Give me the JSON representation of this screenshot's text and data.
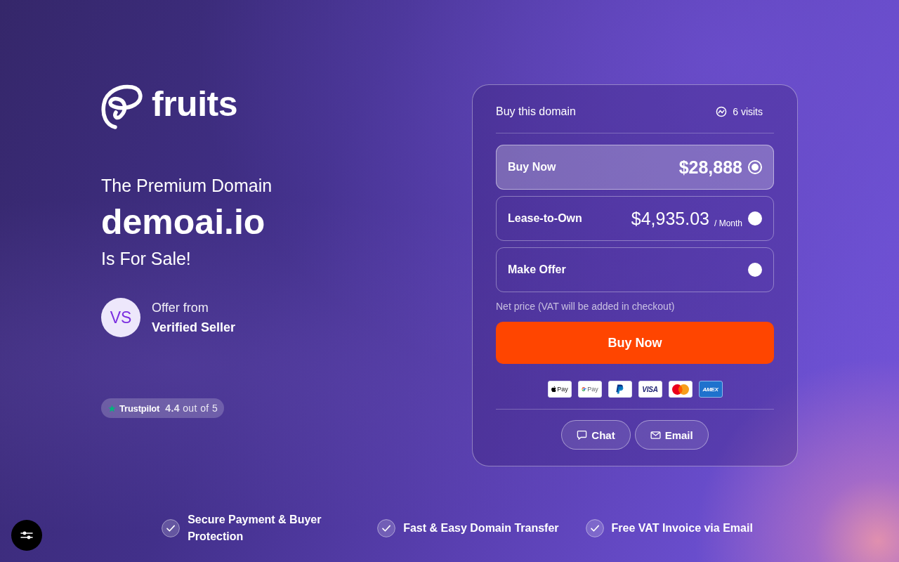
{
  "brand": {
    "name": "fruits"
  },
  "hero": {
    "eyebrow": "The Premium Domain",
    "domain": "demoai.io",
    "tagline": "Is For Sale!"
  },
  "seller": {
    "initials": "VS",
    "caption": "Offer from",
    "name": "Verified Seller"
  },
  "rating": {
    "source": "Trustpilot",
    "score": "**4.4** out of 5"
  },
  "card": {
    "title": "Buy this domain",
    "visits": "6 visits",
    "options": [
      {
        "label": "Buy Now",
        "price": "$28,888",
        "selected": true
      },
      {
        "label": "Lease-to-Own",
        "price": "$4,935.03",
        "unit": "/ Month",
        "selected": false
      },
      {
        "label": "Make Offer",
        "selected": false
      }
    ],
    "note": "Net price (VAT will be added in checkout)",
    "cta": "Buy Now",
    "payment_methods": [
      {
        "kind": "apple-pay",
        "label": "Pay"
      },
      {
        "kind": "google-pay",
        "label": "Pay"
      },
      {
        "kind": "paypal"
      },
      {
        "kind": "visa",
        "label": "VISA"
      },
      {
        "kind": "mastercard"
      },
      {
        "kind": "amex",
        "label": "AMEX"
      }
    ],
    "contact_buttons": [
      {
        "kind": "chat",
        "label": "Chat"
      },
      {
        "kind": "email",
        "label": "Email"
      }
    ]
  },
  "features": [
    "Secure Payment & Buyer Protection",
    "Fast & Easy Domain Transfer",
    "Free VAT Invoice via Email"
  ]
}
